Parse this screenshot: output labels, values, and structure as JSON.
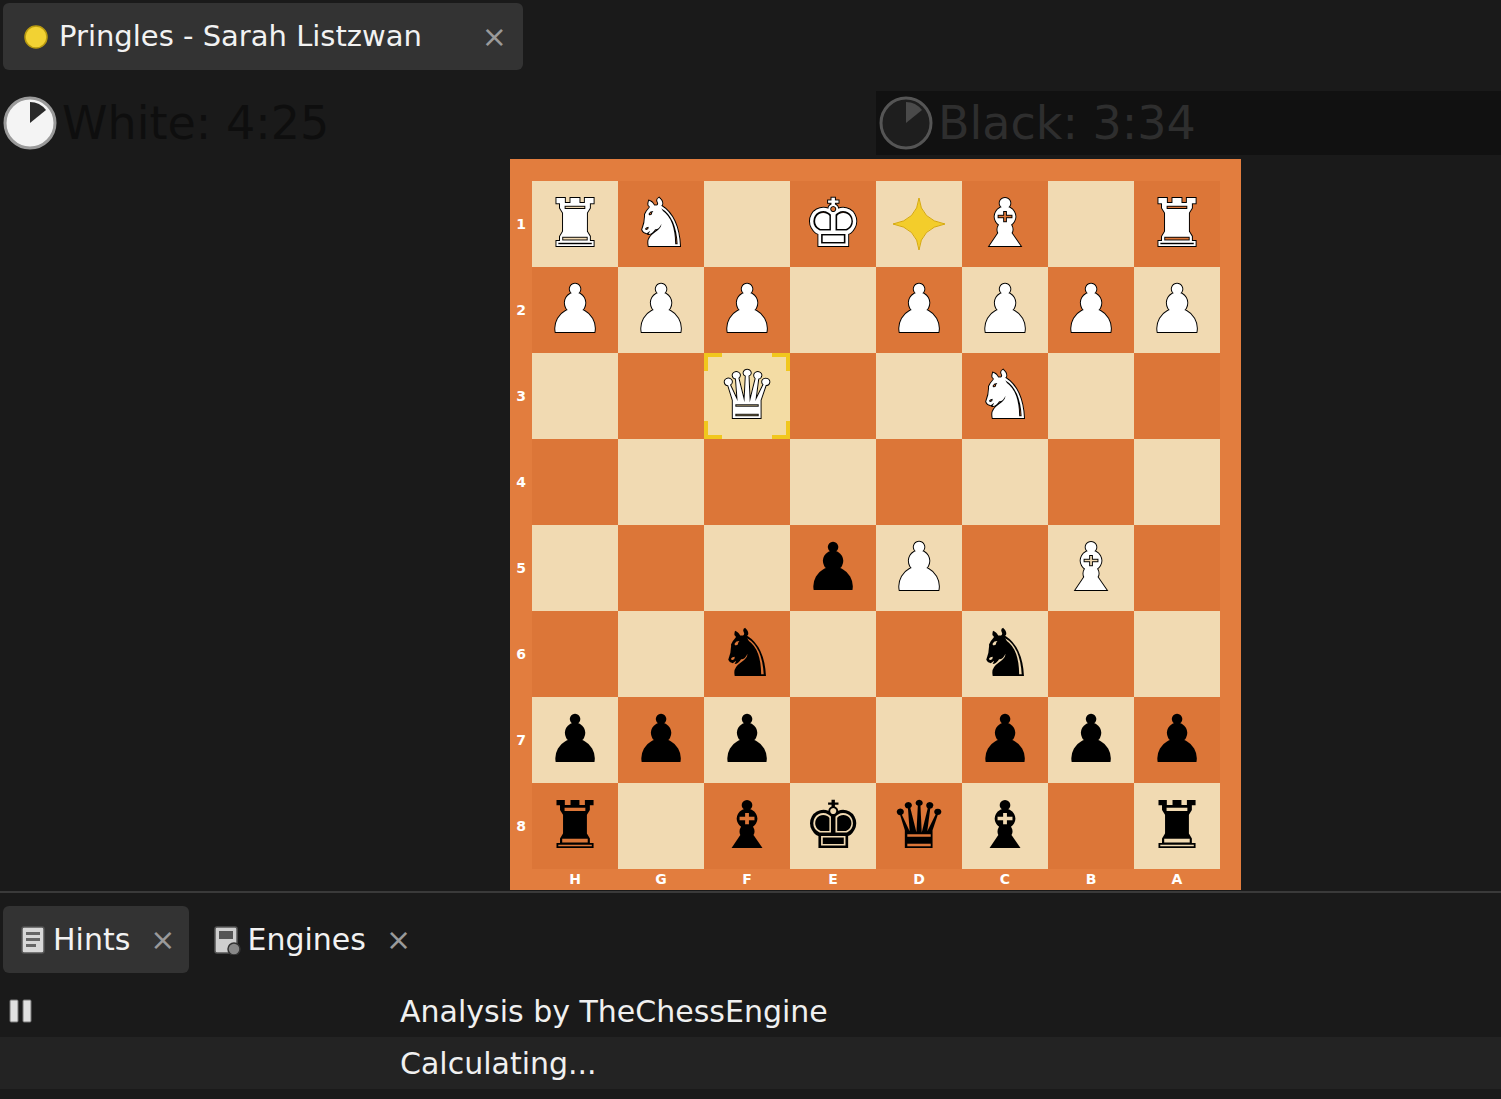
{
  "window": {
    "tab": {
      "label": "Pringles - Sarah Listzwan",
      "close": "×"
    }
  },
  "clocks": [
    {
      "label": "White: 4:25",
      "active": true
    },
    {
      "label": "Black: 3:34",
      "active": false
    }
  ],
  "board": {
    "ranks": [
      "1",
      "2",
      "3",
      "4",
      "5",
      "6",
      "7",
      "8"
    ],
    "files": [
      "H",
      "G",
      "F",
      "E",
      "D",
      "C",
      "B",
      "A"
    ],
    "rows": [
      [
        {
          "piece": "♜",
          "side": "white",
          "highlight": "none"
        },
        {
          "piece": "♞",
          "side": "white",
          "highlight": "none"
        },
        {
          "piece": "",
          "side": "none",
          "highlight": "none"
        },
        {
          "piece": "♚",
          "side": "white",
          "highlight": "none"
        },
        {
          "piece": "",
          "side": "none",
          "highlight": "from"
        },
        {
          "piece": "♝",
          "side": "white",
          "highlight": "none"
        },
        {
          "piece": "",
          "side": "none",
          "highlight": "none"
        },
        {
          "piece": "♜",
          "side": "white",
          "highlight": "none"
        }
      ],
      [
        {
          "piece": "♟",
          "side": "white",
          "highlight": "none"
        },
        {
          "piece": "♟",
          "side": "white",
          "highlight": "none"
        },
        {
          "piece": "♟",
          "side": "white",
          "highlight": "none"
        },
        {
          "piece": "",
          "side": "none",
          "highlight": "none"
        },
        {
          "piece": "♟",
          "side": "white",
          "highlight": "none"
        },
        {
          "piece": "♟",
          "side": "white",
          "highlight": "none"
        },
        {
          "piece": "♟",
          "side": "white",
          "highlight": "none"
        },
        {
          "piece": "♟",
          "side": "white",
          "highlight": "none"
        }
      ],
      [
        {
          "piece": "",
          "side": "none",
          "highlight": "none"
        },
        {
          "piece": "",
          "side": "none",
          "highlight": "none"
        },
        {
          "piece": "♛",
          "side": "white",
          "highlight": "to"
        },
        {
          "piece": "",
          "side": "none",
          "highlight": "none"
        },
        {
          "piece": "",
          "side": "none",
          "highlight": "none"
        },
        {
          "piece": "♞",
          "side": "white",
          "highlight": "none"
        },
        {
          "piece": "",
          "side": "none",
          "highlight": "none"
        },
        {
          "piece": "",
          "side": "none",
          "highlight": "none"
        }
      ],
      [
        {
          "piece": "",
          "side": "none",
          "highlight": "none"
        },
        {
          "piece": "",
          "side": "none",
          "highlight": "none"
        },
        {
          "piece": "",
          "side": "none",
          "highlight": "none"
        },
        {
          "piece": "",
          "side": "none",
          "highlight": "none"
        },
        {
          "piece": "",
          "side": "none",
          "highlight": "none"
        },
        {
          "piece": "",
          "side": "none",
          "highlight": "none"
        },
        {
          "piece": "",
          "side": "none",
          "highlight": "none"
        },
        {
          "piece": "",
          "side": "none",
          "highlight": "none"
        }
      ],
      [
        {
          "piece": "",
          "side": "none",
          "highlight": "none"
        },
        {
          "piece": "",
          "side": "none",
          "highlight": "none"
        },
        {
          "piece": "",
          "side": "none",
          "highlight": "none"
        },
        {
          "piece": "♟",
          "side": "black",
          "highlight": "none"
        },
        {
          "piece": "♟",
          "side": "white",
          "highlight": "none"
        },
        {
          "piece": "",
          "side": "none",
          "highlight": "none"
        },
        {
          "piece": "♝",
          "side": "white",
          "highlight": "none"
        },
        {
          "piece": "",
          "side": "none",
          "highlight": "none"
        }
      ],
      [
        {
          "piece": "",
          "side": "none",
          "highlight": "none"
        },
        {
          "piece": "",
          "side": "none",
          "highlight": "none"
        },
        {
          "piece": "♞",
          "side": "black",
          "highlight": "none"
        },
        {
          "piece": "",
          "side": "none",
          "highlight": "none"
        },
        {
          "piece": "",
          "side": "none",
          "highlight": "none"
        },
        {
          "piece": "♞",
          "side": "black",
          "highlight": "none"
        },
        {
          "piece": "",
          "side": "none",
          "highlight": "none"
        },
        {
          "piece": "",
          "side": "none",
          "highlight": "none"
        }
      ],
      [
        {
          "piece": "♟",
          "side": "black",
          "highlight": "none"
        },
        {
          "piece": "♟",
          "side": "black",
          "highlight": "none"
        },
        {
          "piece": "♟",
          "side": "black",
          "highlight": "none"
        },
        {
          "piece": "",
          "side": "none",
          "highlight": "none"
        },
        {
          "piece": "",
          "side": "none",
          "highlight": "none"
        },
        {
          "piece": "♟",
          "side": "black",
          "highlight": "none"
        },
        {
          "piece": "♟",
          "side": "black",
          "highlight": "none"
        },
        {
          "piece": "♟",
          "side": "black",
          "highlight": "none"
        }
      ],
      [
        {
          "piece": "♜",
          "side": "black",
          "highlight": "none"
        },
        {
          "piece": "",
          "side": "none",
          "highlight": "none"
        },
        {
          "piece": "♝",
          "side": "black",
          "highlight": "none"
        },
        {
          "piece": "♚",
          "side": "black",
          "highlight": "none"
        },
        {
          "piece": "♛",
          "side": "black",
          "highlight": "none"
        },
        {
          "piece": "♝",
          "side": "black",
          "highlight": "none"
        },
        {
          "piece": "",
          "side": "none",
          "highlight": "none"
        },
        {
          "piece": "♜",
          "side": "black",
          "highlight": "none"
        }
      ]
    ]
  },
  "panel": {
    "tabs": [
      {
        "label": "Hints",
        "close": "×",
        "selected": true
      },
      {
        "label": "Engines",
        "close": "×",
        "selected": false
      }
    ],
    "rows": [
      "Analysis by TheChessEngine",
      "Calculating..."
    ]
  }
}
